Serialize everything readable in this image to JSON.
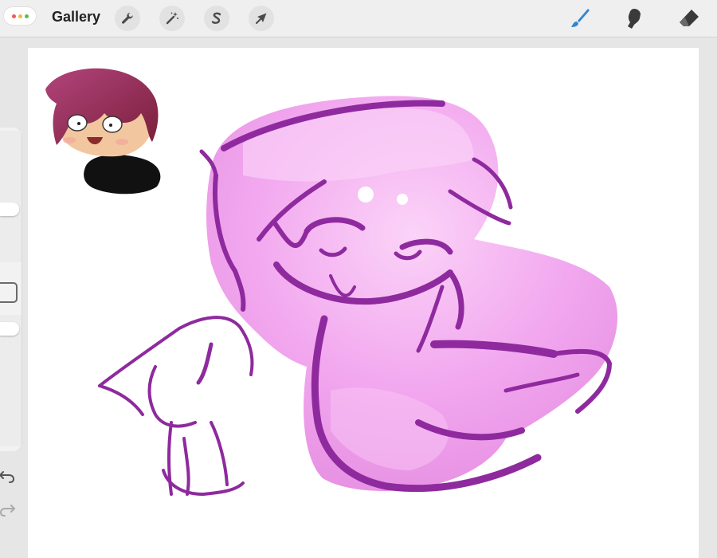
{
  "app": {
    "gallery_label": "Gallery",
    "window_dot_colors": [
      "#f05a5a",
      "#f5b93d",
      "#52c05a"
    ]
  },
  "toolbar": {
    "left_tools": [
      {
        "name": "actions",
        "icon": "wrench-icon"
      },
      {
        "name": "adjustments",
        "icon": "magic-wand-icon"
      },
      {
        "name": "selection",
        "icon": "selection-s-icon"
      },
      {
        "name": "transform",
        "icon": "arrow-cursor-icon"
      }
    ],
    "right_tools": [
      {
        "name": "brush",
        "icon": "brush-icon",
        "active": true
      },
      {
        "name": "smudge",
        "icon": "smudge-icon",
        "active": false
      },
      {
        "name": "eraser",
        "icon": "eraser-icon",
        "active": false
      }
    ]
  },
  "sidebar": {
    "brush_size_icon": "slider-thumb",
    "opacity_icon": "slider-thumb",
    "modify_icon": "square-outline-icon",
    "undo_icon": "undo-icon",
    "redo_icon": "redo-icon"
  },
  "colors": {
    "accent_brush": "#2f86d6",
    "sketch_purple": "#8e2a9e",
    "fill_pink": "#ef9ced",
    "highlight_pink": "#fbd3f8",
    "hair_red": "#9a2545",
    "hoodie_black": "#141414"
  }
}
